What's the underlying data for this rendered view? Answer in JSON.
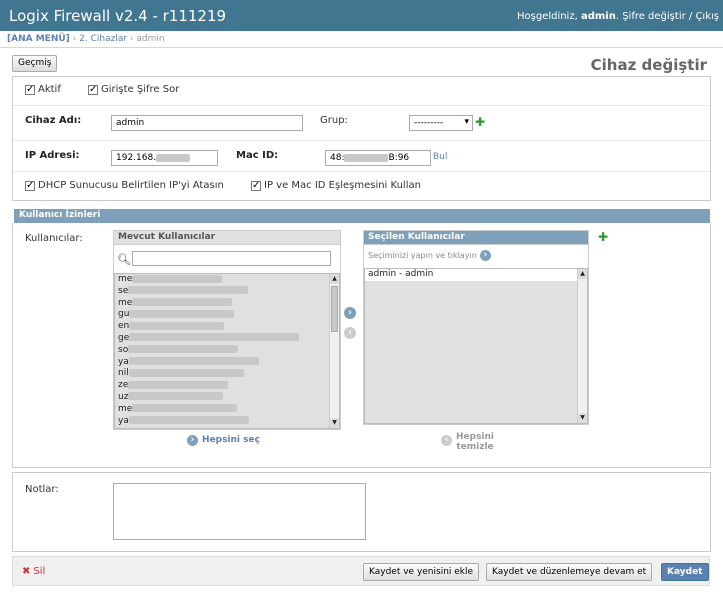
{
  "header": {
    "brand": "Logix Firewall v2.4 - r111219",
    "welcome": "Hoşgeldiniz,",
    "username": "admin",
    "change_password": "Şifre değiştir",
    "separator": "/",
    "logout": "Çıkış"
  },
  "breadcrumb": {
    "home": "[ANA MENÜ]",
    "sep1": "›",
    "section": "2. Cihazlar",
    "sep2": "›",
    "current": "admin"
  },
  "toolbar": {
    "history": "Geçmiş",
    "title": "Cihaz değiştir"
  },
  "form": {
    "active_label": "Aktif",
    "ask_password_label": "Girişte Şifre Sor",
    "device_name_label": "Cihaz Adı:",
    "device_name_value": "admin",
    "group_label": "Grup:",
    "group_selected": "---------",
    "ip_label": "IP Adresi:",
    "ip_value": "192.168.",
    "mac_label": "Mac ID:",
    "mac_prefix": "48:",
    "mac_suffix": "B:96",
    "find_link": "Bul",
    "dhcp_label": "DHCP Sunucusu Belirtilen IP'yi Atasın",
    "ipmac_label": "IP ve Mac ID Eşleşmesini Kullan"
  },
  "permissions": {
    "section_title": "Kullanıcı İzinleri",
    "users_label": "Kullanıcılar:",
    "available_title": "Mevcut Kullanıcılar",
    "search_value": "",
    "available_items": [
      "me",
      "se",
      "me",
      "gu",
      "en",
      "ge",
      "so",
      "ya",
      "nil",
      "ze",
      "uz",
      "me",
      "ya"
    ],
    "chosen_title": "Seçilen Kullanıcılar",
    "chosen_help": "Seçiminizi yapın ve tıklayın",
    "chosen_items": [
      "admin - admin"
    ],
    "choose_all": "Hepsini seç",
    "clear_all_1": "Hepsini",
    "clear_all_2": "temizle"
  },
  "notes": {
    "label": "Notlar:"
  },
  "footer": {
    "delete": "Sil",
    "save_add": "Kaydet ve yenisini ekle",
    "save_continue": "Kaydet ve düzenlemeye devam et",
    "save": "Kaydet"
  },
  "colors": {
    "header_bg": "#417690",
    "accent": "#7fa0bb",
    "link": "#5b80b2",
    "delete": "#cc3434"
  }
}
